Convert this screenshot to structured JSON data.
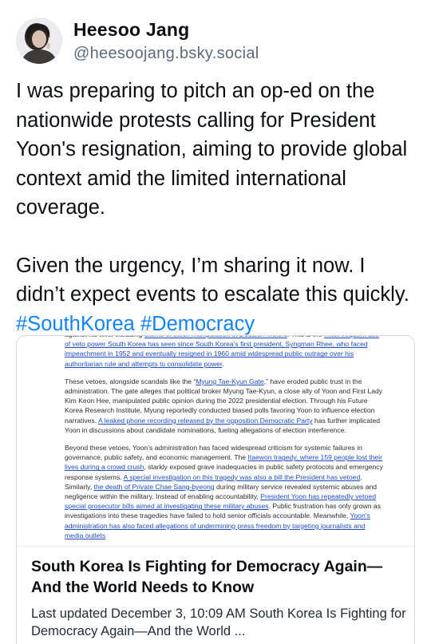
{
  "author": {
    "display_name": "Heesoo Jang",
    "handle": "@heesoojang.bsky.social"
  },
  "post": {
    "paragraph1": "I was preparing to pitch an op-ed on the nationwide protests calling for President Yoon's resignation, aiming to provide global context amid the limited international coverage.",
    "paragraph2_text": "Given the urgency, I’m sharing it now. I didn’t expect events to escalate this quickly. ",
    "hashtags": [
      "#SouthKorea",
      "#Democracy"
    ]
  },
  "link_card": {
    "thumbnail_text": {
      "p1": [
        {
          "t": "against his wife, including "
        },
        {
          "t": "claims of stock manipulation in Deutsch Motors",
          "link": true
        },
        {
          "t": ". This is the "
        },
        {
          "t": "most frequent use of veto power South Korea has seen since South Korea’s first president, Syngman Rhee, who faced impeachment in 1952 and eventually resigned in 1960 amid widespread public outrage over his authoritarian rule and attempts to consolidate power",
          "link": true
        },
        {
          "t": "."
        }
      ],
      "p2": [
        {
          "t": "These vetoes, alongside scandals like the “"
        },
        {
          "t": "Myung Tae-Kyun Gate",
          "link": true
        },
        {
          "t": ",” have eroded public trust in the administration. The gate alleges that political broker Myung Tae-Kyun, a close ally of Yoon and First Lady Kim Keon Hee, manipulated public opinion during the 2022 presidential election. Through his Future Korea Research Institute, Myung reportedly conducted biased polls favoring Yoon to influence election narratives. "
        },
        {
          "t": "A leaked phone recording released by the opposition Democratic Party",
          "link": true
        },
        {
          "t": " has further implicated Yoon in discussions about candidate nominations, fueling allegations of election interference."
        }
      ],
      "p3": [
        {
          "t": "Beyond these vetoes, Yoon’s administration has faced widespread criticism for systemic failures in governance, public safety, and economic management. The "
        },
        {
          "t": "Itaewon tragedy, where 159 people lost their lives during a crowd crush",
          "link": true
        },
        {
          "t": ", starkly exposed grave inadequacies in public safety protocols and emergency response systems. "
        },
        {
          "t": "A special investigation on this tragedy was also a bill the President has vetoed",
          "link": true
        },
        {
          "t": ". Similarly, "
        },
        {
          "t": "the death of Private Chae Sang-byeong",
          "link": true
        },
        {
          "t": " during military service revealed systemic abuses and negligence within the military. Instead of enabling accountability, "
        },
        {
          "t": "President Yoon has repeatedly vetoed special prosecutor bills aimed at investigating these military abuses",
          "link": true
        },
        {
          "t": ". Public frustration has only grown as investigations into these tragedies have failed to hold senior officials accountable. Meanwhile, "
        },
        {
          "t": "Yoon’s administration has also faced allegations of undermining press freedom by targeting journalists and media outlets",
          "link": true
        }
      ]
    },
    "title": "South Korea Is Fighting for Democracy Again—And the World Needs to Know",
    "description": "Last updated December 3, 10:09 AM  South Korea Is Fighting for Democracy Again—And the World ..."
  },
  "colors": {
    "hashtag": "#1083fe",
    "handle": "#5b6b7b",
    "card_border": "#d4dbe2",
    "thumb_link": "#1e4fc2"
  },
  "icons": {
    "avatar": "profile-photo-avatar"
  }
}
